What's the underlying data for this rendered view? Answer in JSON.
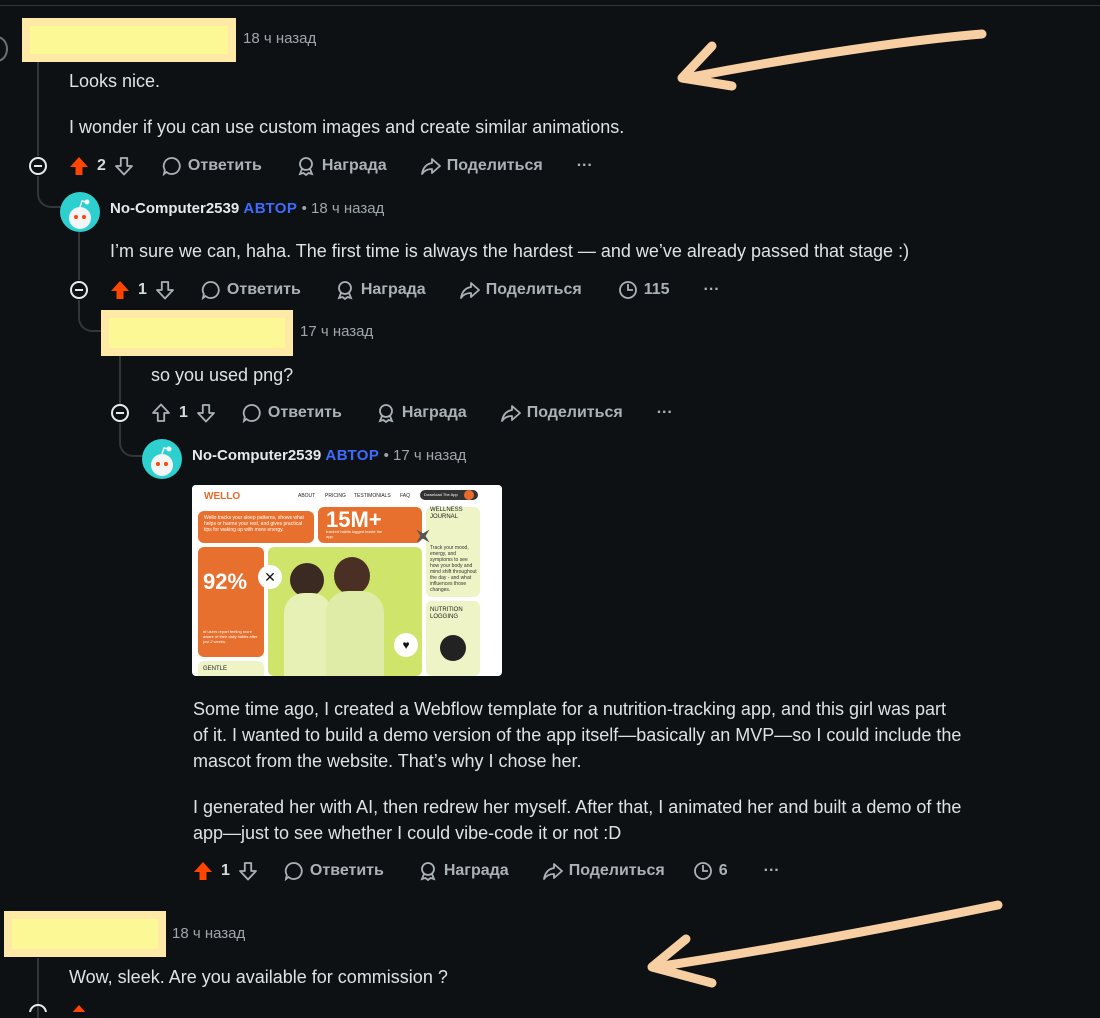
{
  "colors": {
    "background": "#0e1113",
    "upvote": "#ff4500",
    "op_badge": "#3d6bff",
    "redaction": "#fbf895",
    "arrow": "#f8cfa3"
  },
  "comments": [
    {
      "author": "",
      "time": "18 ч назад",
      "body": [
        "Looks nice.",
        "I wonder if you can use custom images and create similar animations."
      ],
      "votes": "2",
      "upvoted": true,
      "reply": "Ответить",
      "award": "Награда",
      "share": "Поделиться",
      "more": "···"
    },
    {
      "author": "No-Computer2539",
      "op_badge": "АВТОР",
      "separator": "•",
      "time": "18 ч назад",
      "body": [
        "I’m sure we can, haha. The first time is always the hardest — and we’ve already passed that stage :)"
      ],
      "votes": "1",
      "upvoted": true,
      "reply": "Ответить",
      "award": "Награда",
      "share": "Поделиться",
      "views": "115",
      "more": "···"
    },
    {
      "author": "",
      "time": "17 ч назад",
      "body": [
        "so you used png?"
      ],
      "votes": "1",
      "upvoted": false,
      "reply": "Ответить",
      "award": "Награда",
      "share": "Поделиться",
      "more": "···"
    },
    {
      "author": "No-Computer2539",
      "op_badge": "АВТОР",
      "separator": "•",
      "time": "17 ч назад",
      "image": {
        "logo": "WELLO",
        "nav": [
          "ABOUT",
          "PRICING",
          "TESTIMONIALS",
          "FAQ"
        ],
        "cta": "Download The App",
        "card1_text": "Wello tracks your sleep patterns, shows what helps or harms your rest, and gives practical tips for waking up with more energy.",
        "stat_big": "15M+",
        "stat_big_caption": "tracked habits logged inside the app.",
        "journal_title": "WELLNESS JOURNAL",
        "journal_text": "Track your mood, energy, and symptoms to see how your body and mind shift throughout the day - and what influences those changes.",
        "percent": "92%",
        "percent_caption": "of users report feeling more aware of their daily habits after just 2 weeks.",
        "nutrition": "NUTRITION LOGGING",
        "gentle": "GENTLE"
      },
      "body": [
        "Some time ago, I created a Webflow template for a nutrition-tracking app, and this girl was part of it. I wanted to build a demo version of the app itself—basically an MVP—so I could include the mascot from the website. That’s why I chose her.",
        "I generated her with AI, then redrew her myself. After that, I animated her and built a demo of the app—just to see whether I could vibe-code it or not :D"
      ],
      "votes": "1",
      "upvoted": true,
      "reply": "Ответить",
      "award": "Награда",
      "share": "Поделиться",
      "views": "6",
      "more": "···"
    },
    {
      "author": "",
      "time": "18 ч назад",
      "body": [
        "Wow, sleek. Are you available for commission ?"
      ]
    }
  ]
}
